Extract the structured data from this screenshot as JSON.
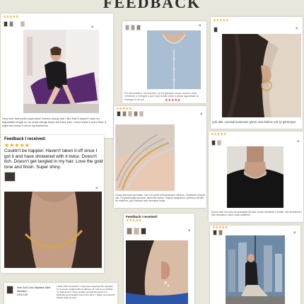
{
  "page": {
    "title": "FEEDBACK"
  },
  "colors": {
    "star": "#f2a516",
    "background": "#e9e7dc",
    "card": "#ffffff"
  },
  "review_1": {
    "stars": "★★★★★",
    "text": "Very nice and looks expensive! Seems sturdy and I like that it doesn't have an adjustable length so no chain hangs down the back part. I don't wear it more than a night and keep it out of my bathroom",
    "close": "×"
  },
  "review_2": {
    "text": "Pre-bemolzaho, recomiendo, ya ha gastado nunca nunca a esta vendedor y si llegan a que muy bonito collar a pesar aguantado la entrega la uso ya",
    "close": "×"
  },
  "review_3": {
    "stars": "★★★★★",
    "text": "Çok tatlı. uzunluk karamsaz görün ama kelime çok iyi görünüyor",
    "close": "×"
  },
  "review_4": {
    "stars": "★★★★★",
    "text": "Супер быстрая доставка, так в 10 дней в Московскую область. Покупала второй раз. Потрясающая цепочка, качество супер. Пакуют аккуратно. Цепочка лёгкая, не тяжёлая, уже больше трёх месяцев ношу.",
    "close": "×"
  },
  "review_5": {
    "heading": "Feedback I received:",
    "stars": "★★★★★",
    "text": "Couldn't be happier. Haven't taken it off since I got it and have showered with it twice. Doesn't itch. Doesn't get tangled in my hair. Love the gold tone and finish. Super shiny.",
    "close": "×"
  },
  "review_6": {
    "stars": "★★★★★",
    "text": "Nunca usei um colar de qualidade tão fina, muito resistente e bonito, não arrebenta e não descasca, estou muito satisfeito.",
    "close": "×"
  },
  "review_7": {
    "heading": "Feedback I received:",
    "stars": "★★★★★",
    "close": "×"
  },
  "review_8": {
    "stars": "★★★★★",
    "close": "×"
  },
  "review_9": {
    "product": "New Gold Color Stainless Steel Necklace...",
    "price": "US $ 1.66",
    "text": "LOVE THIS SO MUCH. I have been wearing this necklace for 2 weeks straight without taking it off, and to our spilling my happiness!! I have worked out and showered in it. Definitely good quality and for the price. I highly recommend. Sturdy clasp as well"
  }
}
